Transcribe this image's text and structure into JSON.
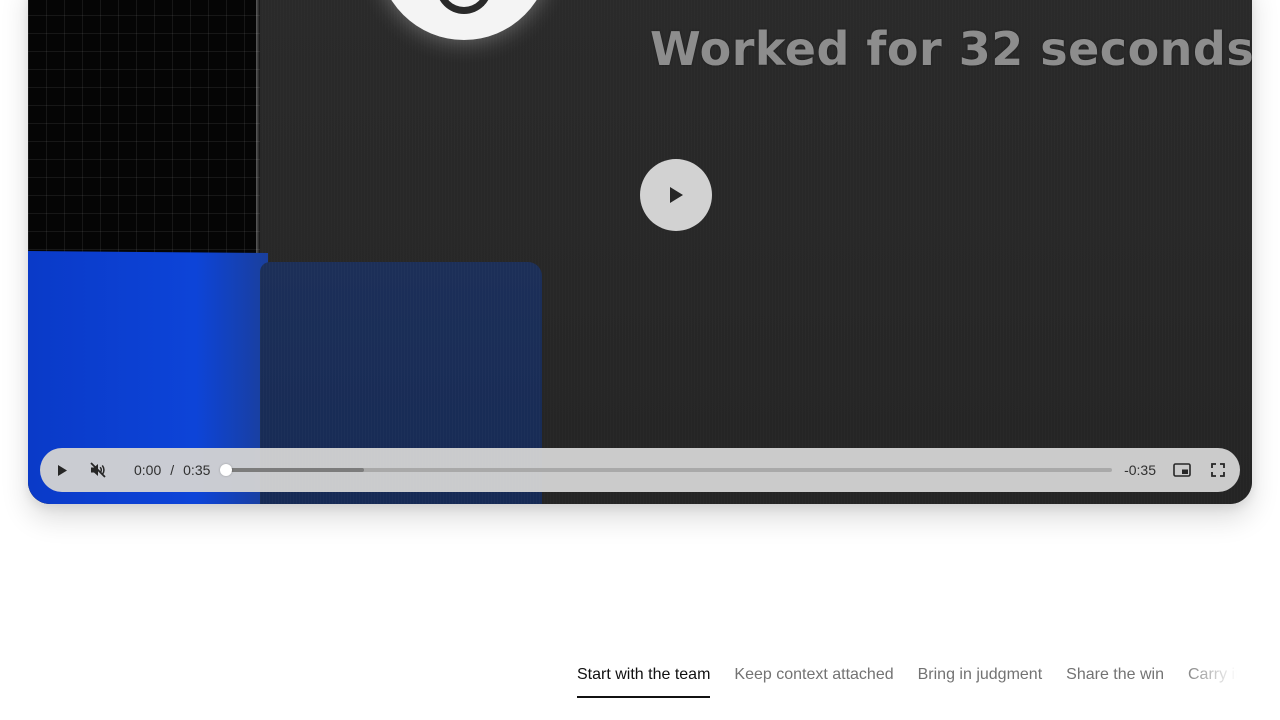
{
  "video": {
    "overlay_text": "Worked for 32 seconds",
    "current_time": "0:00",
    "time_separator": "/",
    "duration": "0:35",
    "remaining": "-0:35",
    "played_fraction": 0.0,
    "buffered_fraction": 0.155,
    "icons": {
      "big_play": "play-icon",
      "play": "play-icon",
      "mute": "volume-muted-icon",
      "pip": "picture-in-picture-icon",
      "fullscreen": "fullscreen-icon"
    }
  },
  "tabs": [
    {
      "label": "Start with the team",
      "active": true
    },
    {
      "label": "Keep context attached",
      "active": false
    },
    {
      "label": "Bring in judgment",
      "active": false
    },
    {
      "label": "Share the win",
      "active": false
    },
    {
      "label": "Carry it",
      "active": false
    }
  ],
  "colors": {
    "accent_blue": "#0d44d8",
    "control_bar": "#d2d2d2",
    "tab_active": "#111111",
    "tab_inactive": "#737373"
  }
}
